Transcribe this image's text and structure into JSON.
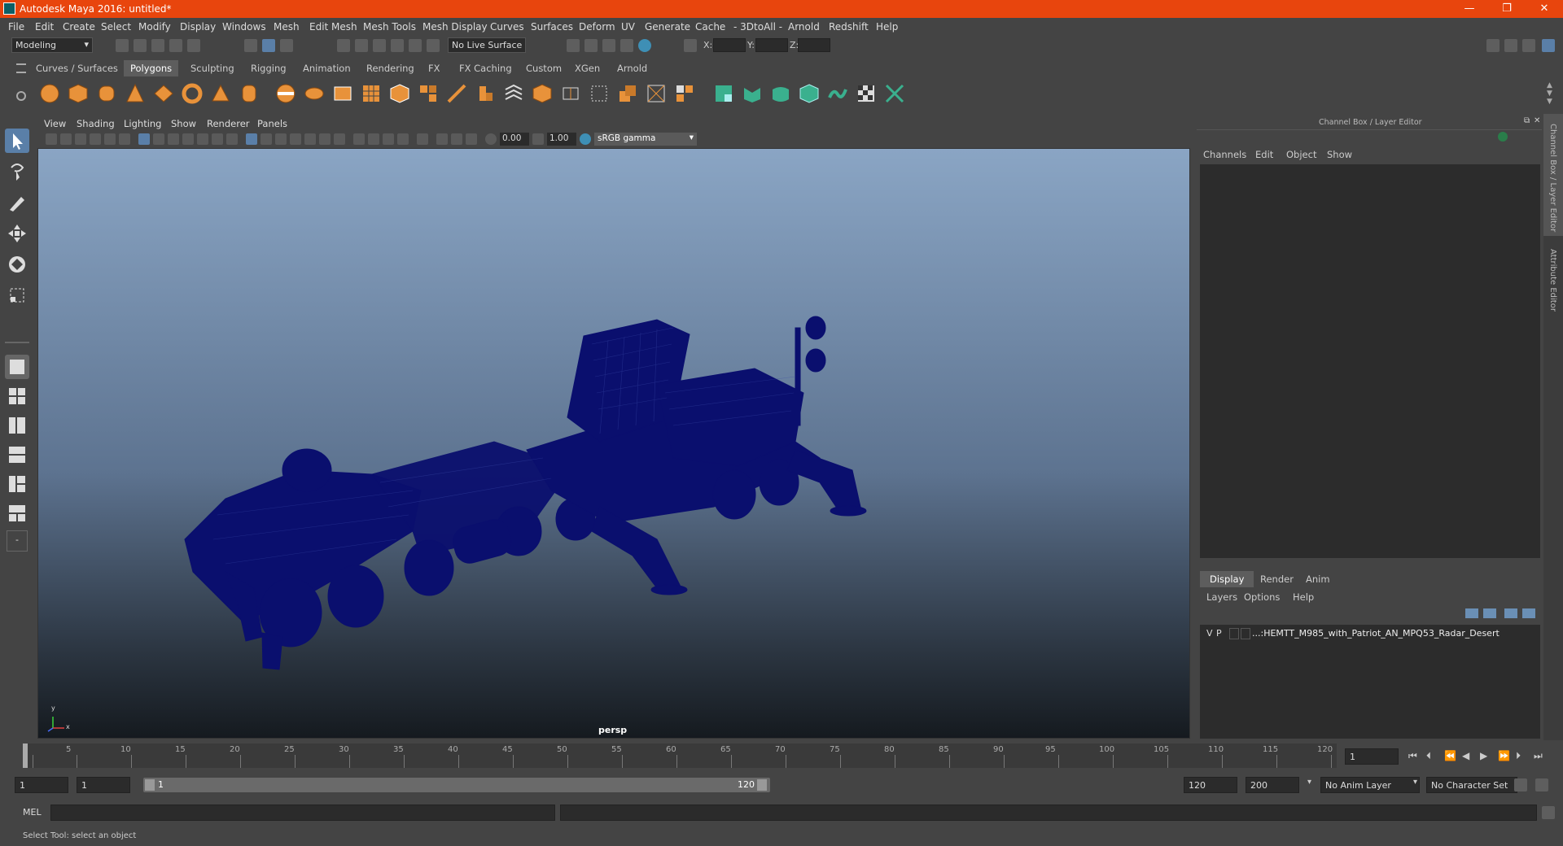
{
  "window": {
    "title": "Autodesk Maya 2016: untitled*",
    "controls": [
      "—",
      "❐",
      "✕"
    ]
  },
  "menubar": [
    "File",
    "Edit",
    "Create",
    "Select",
    "Modify",
    "Display",
    "Windows",
    "Mesh",
    "Edit Mesh",
    "Mesh Tools",
    "Mesh Display",
    "Curves",
    "Surfaces",
    "Deform",
    "UV",
    "Generate",
    "Cache",
    "- 3DtoAll -",
    "Arnold",
    "Redshift",
    "Help"
  ],
  "statusline": {
    "mode": "Modeling",
    "live_surface": "No Live Surface",
    "x_label": "X:",
    "y_label": "Y:",
    "z_label": "Z:"
  },
  "shelf": {
    "tabs": [
      "Curves / Surfaces",
      "Polygons",
      "Sculpting",
      "Rigging",
      "Animation",
      "Rendering",
      "FX",
      "FX Caching",
      "Custom",
      "XGen",
      "Arnold"
    ],
    "active_tab": "Polygons"
  },
  "viewport": {
    "menu": [
      "View",
      "Shading",
      "Lighting",
      "Show",
      "Renderer",
      "Panels"
    ],
    "exposure": "0.00",
    "gamma": "1.00",
    "color_space": "sRGB gamma",
    "camera_label": "persp",
    "axis_y": "y",
    "axis_x": "x"
  },
  "channel_box": {
    "title": "Channel Box / Layer Editor",
    "menu": [
      "Channels",
      "Edit",
      "Object",
      "Show"
    ]
  },
  "layer_editor": {
    "tabs": [
      "Display",
      "Render",
      "Anim"
    ],
    "active_tab": "Display",
    "menu": [
      "Layers",
      "Options",
      "Help"
    ],
    "layers": [
      {
        "v": "V",
        "p": "P",
        "name": "...:HEMTT_M985_with_Patriot_AN_MPQ53_Radar_Desert"
      }
    ]
  },
  "side_tabs": [
    "Channel Box / Layer Editor",
    "Attribute Editor"
  ],
  "timeline": {
    "ticks": [
      1,
      5,
      10,
      15,
      20,
      25,
      30,
      35,
      40,
      45,
      50,
      55,
      60,
      65,
      70,
      75,
      80,
      85,
      90,
      95,
      100,
      105,
      110,
      115,
      120
    ],
    "current_frame": "1"
  },
  "range": {
    "start": "1",
    "playback_start": "1",
    "slider_left": "1",
    "slider_right": "120",
    "playback_end": "120",
    "end": "200",
    "anim_layer": "No Anim Layer",
    "character_set": "No Character Set"
  },
  "command_line": {
    "label": "MEL"
  },
  "help_line": "Select Tool: select an object",
  "colors": {
    "title_bar": "#e8450d",
    "accent_tab": "#5d5d5d",
    "wireframe": "#0a0f6e",
    "shelf_orange": "#e8923a",
    "shelf_teal": "#3ab08e"
  }
}
